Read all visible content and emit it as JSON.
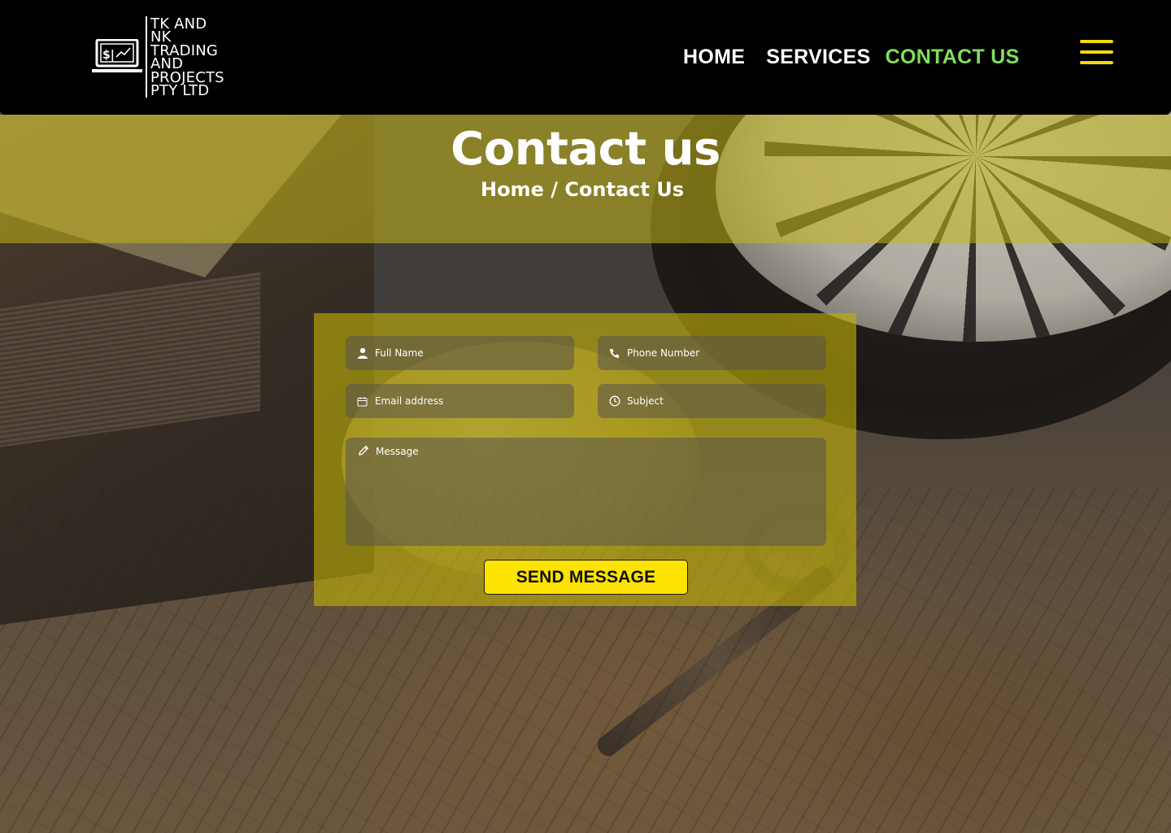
{
  "brand": {
    "lines": [
      "TK AND",
      "NK",
      "TRADING",
      "AND",
      "PROJECTS",
      "PTY LTD"
    ],
    "logo_icon": "laptop-chart-icon",
    "logo_glyph": "$|"
  },
  "nav": {
    "home": "HOME",
    "services": "SERVICES",
    "contact": "CONTACT US",
    "menu_icon": "hamburger-menu-icon"
  },
  "banner": {
    "title": "Contact us",
    "breadcrumb": "Home / Contact Us"
  },
  "form": {
    "full_name_placeholder": "Full Name",
    "phone_placeholder": "Phone Number",
    "email_placeholder": "Email address",
    "subject_placeholder": "Subject",
    "message_placeholder": "Message",
    "submit_label": "SEND MESSAGE"
  },
  "colors": {
    "header_bg": "#000000",
    "nav_active": "#7ee05a",
    "accent_yellow": "#fde300",
    "menu_icon": "#f2d80f",
    "overlay_yellow": "#c5b718"
  }
}
